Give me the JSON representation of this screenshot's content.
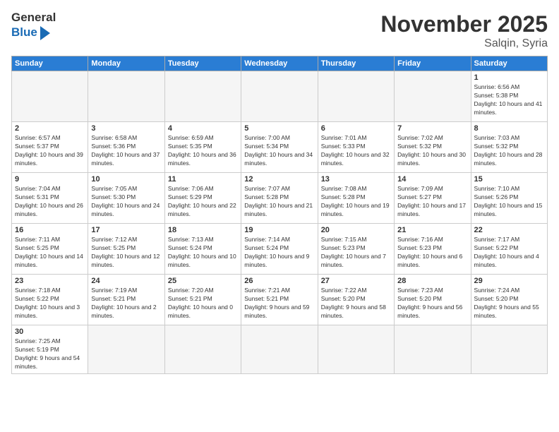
{
  "logo": {
    "general": "General",
    "blue": "Blue"
  },
  "header": {
    "month": "November 2025",
    "location": "Salqin, Syria"
  },
  "weekdays": [
    "Sunday",
    "Monday",
    "Tuesday",
    "Wednesday",
    "Thursday",
    "Friday",
    "Saturday"
  ],
  "weeks": [
    [
      {
        "day": "",
        "empty": true
      },
      {
        "day": "",
        "empty": true
      },
      {
        "day": "",
        "empty": true
      },
      {
        "day": "",
        "empty": true
      },
      {
        "day": "",
        "empty": true
      },
      {
        "day": "",
        "empty": true
      },
      {
        "day": "1",
        "sunrise": "6:56 AM",
        "sunset": "5:38 PM",
        "daylight": "10 hours and 41 minutes."
      }
    ],
    [
      {
        "day": "2",
        "sunrise": "6:57 AM",
        "sunset": "5:37 PM",
        "daylight": "10 hours and 39 minutes."
      },
      {
        "day": "3",
        "sunrise": "6:58 AM",
        "sunset": "5:36 PM",
        "daylight": "10 hours and 37 minutes."
      },
      {
        "day": "4",
        "sunrise": "6:59 AM",
        "sunset": "5:35 PM",
        "daylight": "10 hours and 36 minutes."
      },
      {
        "day": "5",
        "sunrise": "7:00 AM",
        "sunset": "5:34 PM",
        "daylight": "10 hours and 34 minutes."
      },
      {
        "day": "6",
        "sunrise": "7:01 AM",
        "sunset": "5:33 PM",
        "daylight": "10 hours and 32 minutes."
      },
      {
        "day": "7",
        "sunrise": "7:02 AM",
        "sunset": "5:32 PM",
        "daylight": "10 hours and 30 minutes."
      },
      {
        "day": "8",
        "sunrise": "7:03 AM",
        "sunset": "5:32 PM",
        "daylight": "10 hours and 28 minutes."
      }
    ],
    [
      {
        "day": "9",
        "sunrise": "7:04 AM",
        "sunset": "5:31 PM",
        "daylight": "10 hours and 26 minutes."
      },
      {
        "day": "10",
        "sunrise": "7:05 AM",
        "sunset": "5:30 PM",
        "daylight": "10 hours and 24 minutes."
      },
      {
        "day": "11",
        "sunrise": "7:06 AM",
        "sunset": "5:29 PM",
        "daylight": "10 hours and 22 minutes."
      },
      {
        "day": "12",
        "sunrise": "7:07 AM",
        "sunset": "5:28 PM",
        "daylight": "10 hours and 21 minutes."
      },
      {
        "day": "13",
        "sunrise": "7:08 AM",
        "sunset": "5:28 PM",
        "daylight": "10 hours and 19 minutes."
      },
      {
        "day": "14",
        "sunrise": "7:09 AM",
        "sunset": "5:27 PM",
        "daylight": "10 hours and 17 minutes."
      },
      {
        "day": "15",
        "sunrise": "7:10 AM",
        "sunset": "5:26 PM",
        "daylight": "10 hours and 15 minutes."
      }
    ],
    [
      {
        "day": "16",
        "sunrise": "7:11 AM",
        "sunset": "5:25 PM",
        "daylight": "10 hours and 14 minutes."
      },
      {
        "day": "17",
        "sunrise": "7:12 AM",
        "sunset": "5:25 PM",
        "daylight": "10 hours and 12 minutes."
      },
      {
        "day": "18",
        "sunrise": "7:13 AM",
        "sunset": "5:24 PM",
        "daylight": "10 hours and 10 minutes."
      },
      {
        "day": "19",
        "sunrise": "7:14 AM",
        "sunset": "5:24 PM",
        "daylight": "10 hours and 9 minutes."
      },
      {
        "day": "20",
        "sunrise": "7:15 AM",
        "sunset": "5:23 PM",
        "daylight": "10 hours and 7 minutes."
      },
      {
        "day": "21",
        "sunrise": "7:16 AM",
        "sunset": "5:23 PM",
        "daylight": "10 hours and 6 minutes."
      },
      {
        "day": "22",
        "sunrise": "7:17 AM",
        "sunset": "5:22 PM",
        "daylight": "10 hours and 4 minutes."
      }
    ],
    [
      {
        "day": "23",
        "sunrise": "7:18 AM",
        "sunset": "5:22 PM",
        "daylight": "10 hours and 3 minutes."
      },
      {
        "day": "24",
        "sunrise": "7:19 AM",
        "sunset": "5:21 PM",
        "daylight": "10 hours and 2 minutes."
      },
      {
        "day": "25",
        "sunrise": "7:20 AM",
        "sunset": "5:21 PM",
        "daylight": "10 hours and 0 minutes."
      },
      {
        "day": "26",
        "sunrise": "7:21 AM",
        "sunset": "5:21 PM",
        "daylight": "9 hours and 59 minutes."
      },
      {
        "day": "27",
        "sunrise": "7:22 AM",
        "sunset": "5:20 PM",
        "daylight": "9 hours and 58 minutes."
      },
      {
        "day": "28",
        "sunrise": "7:23 AM",
        "sunset": "5:20 PM",
        "daylight": "9 hours and 56 minutes."
      },
      {
        "day": "29",
        "sunrise": "7:24 AM",
        "sunset": "5:20 PM",
        "daylight": "9 hours and 55 minutes."
      }
    ],
    [
      {
        "day": "30",
        "sunrise": "7:25 AM",
        "sunset": "5:19 PM",
        "daylight": "9 hours and 54 minutes.",
        "last": true
      },
      {
        "day": "",
        "empty": true,
        "last": true
      },
      {
        "day": "",
        "empty": true,
        "last": true
      },
      {
        "day": "",
        "empty": true,
        "last": true
      },
      {
        "day": "",
        "empty": true,
        "last": true
      },
      {
        "day": "",
        "empty": true,
        "last": true
      },
      {
        "day": "",
        "empty": true,
        "last": true
      }
    ]
  ]
}
